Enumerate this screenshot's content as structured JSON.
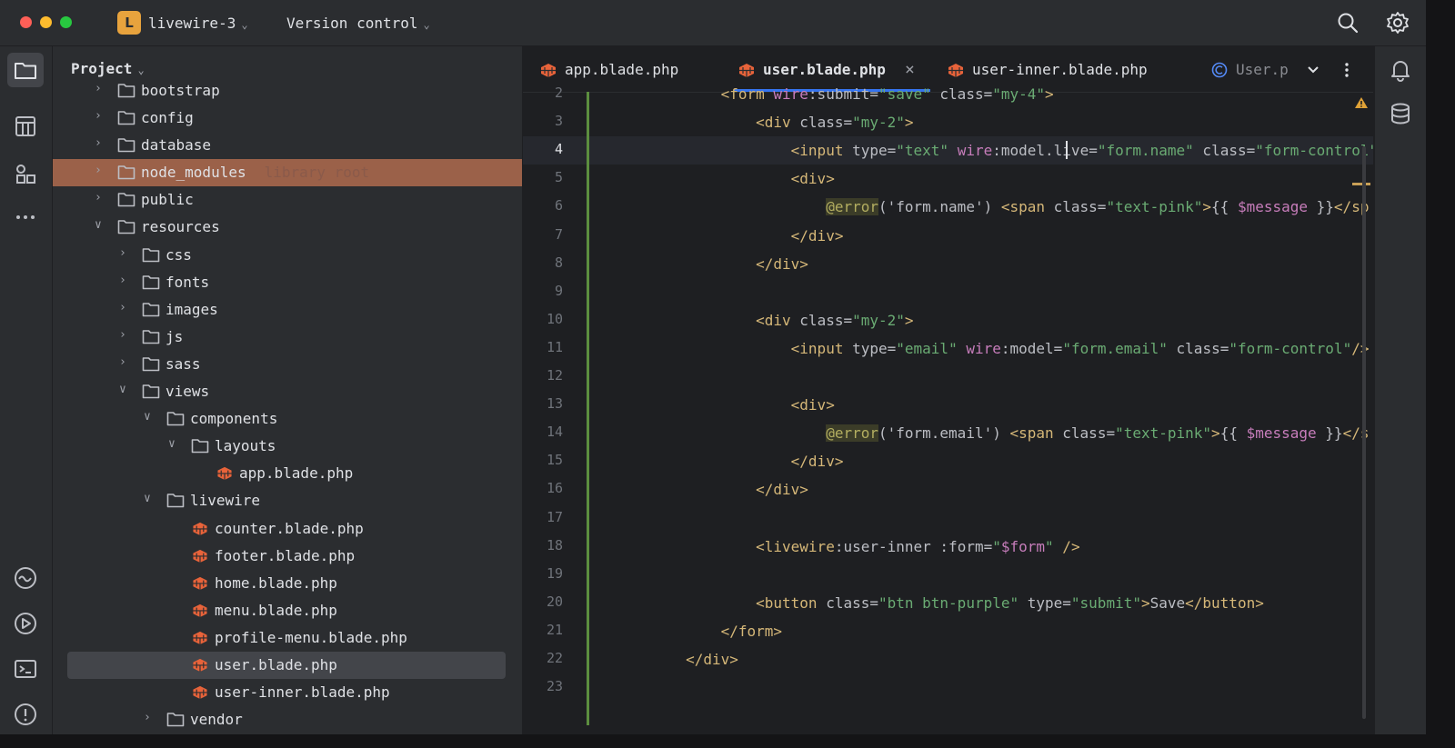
{
  "window": {
    "project_badge": "L",
    "project_name": "livewire-3",
    "vcs_label": "Version control"
  },
  "project_panel": {
    "title": "Project",
    "tree": [
      {
        "label": "bootstrap",
        "type": "folder",
        "depth": 1,
        "expanded": false
      },
      {
        "label": "config",
        "type": "folder",
        "depth": 1,
        "expanded": false
      },
      {
        "label": "database",
        "type": "folder",
        "depth": 1,
        "expanded": false
      },
      {
        "label": "node_modules",
        "type": "folder",
        "depth": 1,
        "expanded": false,
        "hint": "library root",
        "highlight": true
      },
      {
        "label": "public",
        "type": "folder",
        "depth": 1,
        "expanded": false
      },
      {
        "label": "resources",
        "type": "folder",
        "depth": 1,
        "expanded": true
      },
      {
        "label": "css",
        "type": "folder",
        "depth": 2,
        "expanded": false
      },
      {
        "label": "fonts",
        "type": "folder",
        "depth": 2,
        "expanded": false
      },
      {
        "label": "images",
        "type": "folder",
        "depth": 2,
        "expanded": false
      },
      {
        "label": "js",
        "type": "folder",
        "depth": 2,
        "expanded": false
      },
      {
        "label": "sass",
        "type": "folder",
        "depth": 2,
        "expanded": false
      },
      {
        "label": "views",
        "type": "folder",
        "depth": 2,
        "expanded": true
      },
      {
        "label": "components",
        "type": "folder",
        "depth": 3,
        "expanded": true
      },
      {
        "label": "layouts",
        "type": "folder",
        "depth": 4,
        "expanded": true
      },
      {
        "label": "app.blade.php",
        "type": "file",
        "depth": 5
      },
      {
        "label": "livewire",
        "type": "folder",
        "depth": 3,
        "expanded": true
      },
      {
        "label": "counter.blade.php",
        "type": "file",
        "depth": 4
      },
      {
        "label": "footer.blade.php",
        "type": "file",
        "depth": 4
      },
      {
        "label": "home.blade.php",
        "type": "file",
        "depth": 4
      },
      {
        "label": "menu.blade.php",
        "type": "file",
        "depth": 4
      },
      {
        "label": "profile-menu.blade.php",
        "type": "file",
        "depth": 4
      },
      {
        "label": "user.blade.php",
        "type": "file",
        "depth": 4,
        "selected": true
      },
      {
        "label": "user-inner.blade.php",
        "type": "file",
        "depth": 4
      },
      {
        "label": "vendor",
        "type": "folder",
        "depth": 3,
        "expanded": false
      }
    ]
  },
  "tabs": [
    {
      "label": "app.blade.php",
      "icon": "blade-file-icon"
    },
    {
      "label": "user.blade.php",
      "icon": "blade-file-icon",
      "active": true,
      "closable": true
    },
    {
      "label": "user-inner.blade.php",
      "icon": "blade-file-icon"
    },
    {
      "label": "User.p",
      "icon": "class-icon"
    }
  ],
  "editor": {
    "current_line": 4,
    "lines": [
      {
        "n": "2",
        "tokens": [
          [
            "i",
            "            "
          ],
          [
            "t",
            "<form "
          ],
          [
            "w",
            "wire"
          ],
          [
            "a",
            ":submit="
          ],
          [
            "v",
            "\"save\""
          ],
          [
            "a",
            " class="
          ],
          [
            "v",
            "\"my-4\""
          ],
          [
            "t",
            ">"
          ]
        ]
      },
      {
        "n": "3",
        "tokens": [
          [
            "i",
            "                "
          ],
          [
            "t",
            "<div "
          ],
          [
            "a",
            "class="
          ],
          [
            "v",
            "\"my-2\""
          ],
          [
            "t",
            ">"
          ]
        ]
      },
      {
        "n": "4",
        "tokens": [
          [
            "i",
            "                    "
          ],
          [
            "t",
            "<input "
          ],
          [
            "a",
            "type="
          ],
          [
            "v",
            "\"text\""
          ],
          [
            "a",
            " "
          ],
          [
            "w",
            "wire"
          ],
          [
            "a",
            ":model.live="
          ],
          [
            "v",
            "\"form.name\""
          ],
          [
            "a",
            " class="
          ],
          [
            "v",
            "\"form-control\""
          ]
        ]
      },
      {
        "n": "5",
        "tokens": [
          [
            "i",
            "                    "
          ],
          [
            "t",
            "<div>"
          ]
        ]
      },
      {
        "n": "6",
        "tokens": [
          [
            "i",
            "                        "
          ],
          [
            "dir",
            "@error"
          ],
          [
            "d",
            "('form.name') "
          ],
          [
            "t",
            "<span "
          ],
          [
            "a",
            "class="
          ],
          [
            "v",
            "\"text-pink\""
          ],
          [
            "t",
            ">"
          ],
          [
            "d",
            "{{ "
          ],
          [
            "var",
            "$message"
          ],
          [
            "d",
            " }}"
          ],
          [
            "t",
            "</sp"
          ]
        ]
      },
      {
        "n": "7",
        "tokens": [
          [
            "i",
            "                    "
          ],
          [
            "t",
            "</div>"
          ]
        ]
      },
      {
        "n": "8",
        "tokens": [
          [
            "i",
            "                "
          ],
          [
            "t",
            "</div>"
          ]
        ]
      },
      {
        "n": "9",
        "tokens": []
      },
      {
        "n": "10",
        "tokens": [
          [
            "i",
            "                "
          ],
          [
            "t",
            "<div "
          ],
          [
            "a",
            "class="
          ],
          [
            "v",
            "\"my-2\""
          ],
          [
            "t",
            ">"
          ]
        ]
      },
      {
        "n": "11",
        "tokens": [
          [
            "i",
            "                    "
          ],
          [
            "t",
            "<input "
          ],
          [
            "a",
            "type="
          ],
          [
            "v",
            "\"email\""
          ],
          [
            "a",
            " "
          ],
          [
            "w",
            "wire"
          ],
          [
            "a",
            ":model="
          ],
          [
            "v",
            "\"form.email\""
          ],
          [
            "a",
            " class="
          ],
          [
            "v",
            "\"form-control\""
          ],
          [
            "t",
            "/>"
          ]
        ]
      },
      {
        "n": "12",
        "tokens": []
      },
      {
        "n": "13",
        "tokens": [
          [
            "i",
            "                    "
          ],
          [
            "t",
            "<div>"
          ]
        ]
      },
      {
        "n": "14",
        "tokens": [
          [
            "i",
            "                        "
          ],
          [
            "dir",
            "@error"
          ],
          [
            "d",
            "('form.email') "
          ],
          [
            "t",
            "<span "
          ],
          [
            "a",
            "class="
          ],
          [
            "v",
            "\"text-pink\""
          ],
          [
            "t",
            ">"
          ],
          [
            "d",
            "{{ "
          ],
          [
            "var",
            "$message"
          ],
          [
            "d",
            " }}"
          ],
          [
            "t",
            "</s"
          ]
        ]
      },
      {
        "n": "15",
        "tokens": [
          [
            "i",
            "                    "
          ],
          [
            "t",
            "</div>"
          ]
        ]
      },
      {
        "n": "16",
        "tokens": [
          [
            "i",
            "                "
          ],
          [
            "t",
            "</div>"
          ]
        ]
      },
      {
        "n": "17",
        "tokens": []
      },
      {
        "n": "18",
        "tokens": [
          [
            "i",
            "                "
          ],
          [
            "t",
            "<livewire"
          ],
          [
            "a",
            ":user-inner :form="
          ],
          [
            "v",
            "\""
          ],
          [
            "var",
            "$form"
          ],
          [
            "v",
            "\""
          ],
          [
            "t",
            " />"
          ]
        ]
      },
      {
        "n": "19",
        "tokens": []
      },
      {
        "n": "20",
        "tokens": [
          [
            "i",
            "                "
          ],
          [
            "t",
            "<button "
          ],
          [
            "a",
            "class="
          ],
          [
            "v",
            "\"btn btn-purple\""
          ],
          [
            "a",
            " type="
          ],
          [
            "v",
            "\"submit\""
          ],
          [
            "t",
            ">"
          ],
          [
            "d",
            "Save"
          ],
          [
            "t",
            "</button>"
          ]
        ]
      },
      {
        "n": "21",
        "tokens": [
          [
            "i",
            "            "
          ],
          [
            "t",
            "</form>"
          ]
        ]
      },
      {
        "n": "22",
        "tokens": [
          [
            "i",
            "        "
          ],
          [
            "t",
            "</div>"
          ]
        ]
      },
      {
        "n": "23",
        "tokens": []
      }
    ]
  },
  "colors": {
    "accent": "#3574f0",
    "highlight_row": "#9b6149",
    "tag": "#d5b778",
    "string": "#6aab73",
    "keyword": "#c77dbb"
  }
}
